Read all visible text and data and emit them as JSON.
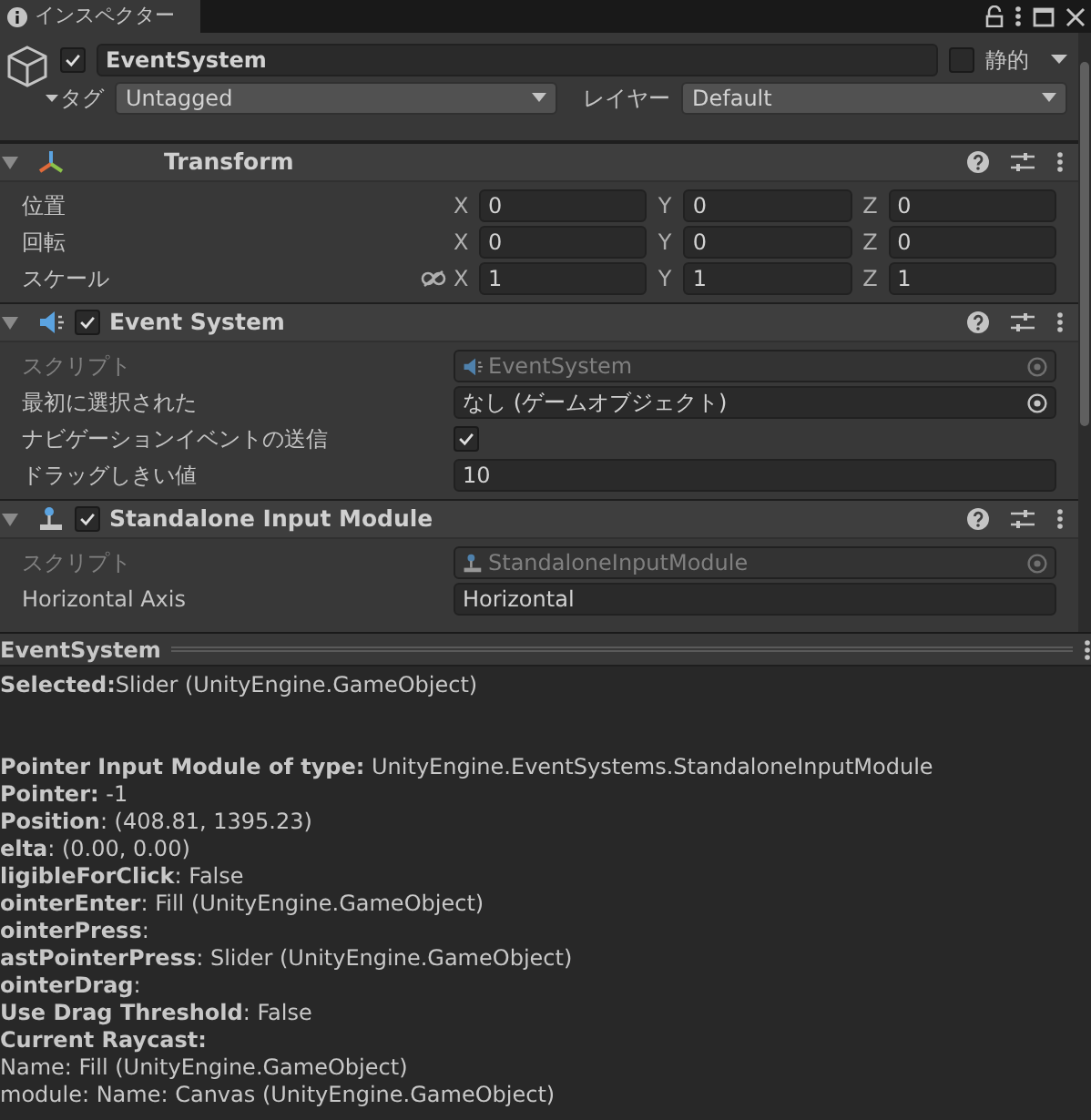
{
  "tab": {
    "title": "インスペクター"
  },
  "object": {
    "active": true,
    "name": "EventSystem",
    "static_label": "静的",
    "static": false,
    "tag_label": "タグ",
    "tag": "Untagged",
    "layer_label": "レイヤー",
    "layer": "Default"
  },
  "components": [
    {
      "kind": "transform",
      "title": "Transform",
      "expanded": true,
      "rows": [
        {
          "kind": "vector",
          "label": "位置",
          "values": [
            {
              "axis": "X",
              "value": "0"
            },
            {
              "axis": "Y",
              "value": "0"
            },
            {
              "axis": "Z",
              "value": "0"
            }
          ]
        },
        {
          "kind": "vector",
          "label": "回転",
          "values": [
            {
              "axis": "X",
              "value": "0"
            },
            {
              "axis": "Y",
              "value": "0"
            },
            {
              "axis": "Z",
              "value": "0"
            }
          ]
        },
        {
          "kind": "vector",
          "label": "スケール",
          "constrained": false,
          "values": [
            {
              "axis": "X",
              "value": "1"
            },
            {
              "axis": "Y",
              "value": "1"
            },
            {
              "axis": "Z",
              "value": "1"
            }
          ]
        }
      ]
    },
    {
      "kind": "event",
      "title": "Event System",
      "enabled": true,
      "expanded": true,
      "rows": [
        {
          "kind": "script",
          "label": "スクリプト",
          "value": "EventSystem",
          "disabled": true
        },
        {
          "kind": "object",
          "label": "最初に選択された",
          "value": "なし (ゲームオブジェクト)",
          "disabled": false
        },
        {
          "kind": "checkbox",
          "label": "ナビゲーションイベントの送信",
          "checked": true
        },
        {
          "kind": "text",
          "label": "ドラッグしきい値",
          "value": "10"
        }
      ]
    },
    {
      "kind": "input",
      "title": "Standalone Input Module",
      "enabled": true,
      "expanded": true,
      "rows": [
        {
          "kind": "script",
          "label": "スクリプト",
          "value": "StandaloneInputModule",
          "disabled": true
        },
        {
          "kind": "text",
          "label": "Horizontal Axis",
          "value": "Horizontal"
        }
      ]
    }
  ],
  "debug": {
    "title": "EventSystem",
    "selection": {
      "label": "Selected:",
      "value": "Slider (UnityEngine.GameObject)"
    },
    "lines": [
      {
        "label": "Pointer Input Module of type:",
        "value": " UnityEngine.EventSystems.StandaloneInputModule"
      },
      {
        "label": "Pointer:",
        "value": " -1"
      },
      {
        "label": "Position",
        "value": ": (408.81, 1395.23)"
      },
      {
        "label": "elta",
        "value": ": (0.00, 0.00)"
      },
      {
        "label": "ligibleForClick",
        "value": ": False"
      },
      {
        "label": "ointerEnter",
        "value": ": Fill (UnityEngine.GameObject)"
      },
      {
        "label": "ointerPress",
        "value": ":"
      },
      {
        "label": "astPointerPress",
        "value": ": Slider (UnityEngine.GameObject)"
      },
      {
        "label": "ointerDrag",
        "value": ":"
      },
      {
        "label": "Use Drag Threshold",
        "value": ": False"
      },
      {
        "label": "Current Raycast:"
      },
      {
        "value": "Name: Fill (UnityEngine.GameObject)"
      },
      {
        "value": "module: Name: Canvas (UnityEngine.GameObject)"
      }
    ]
  }
}
